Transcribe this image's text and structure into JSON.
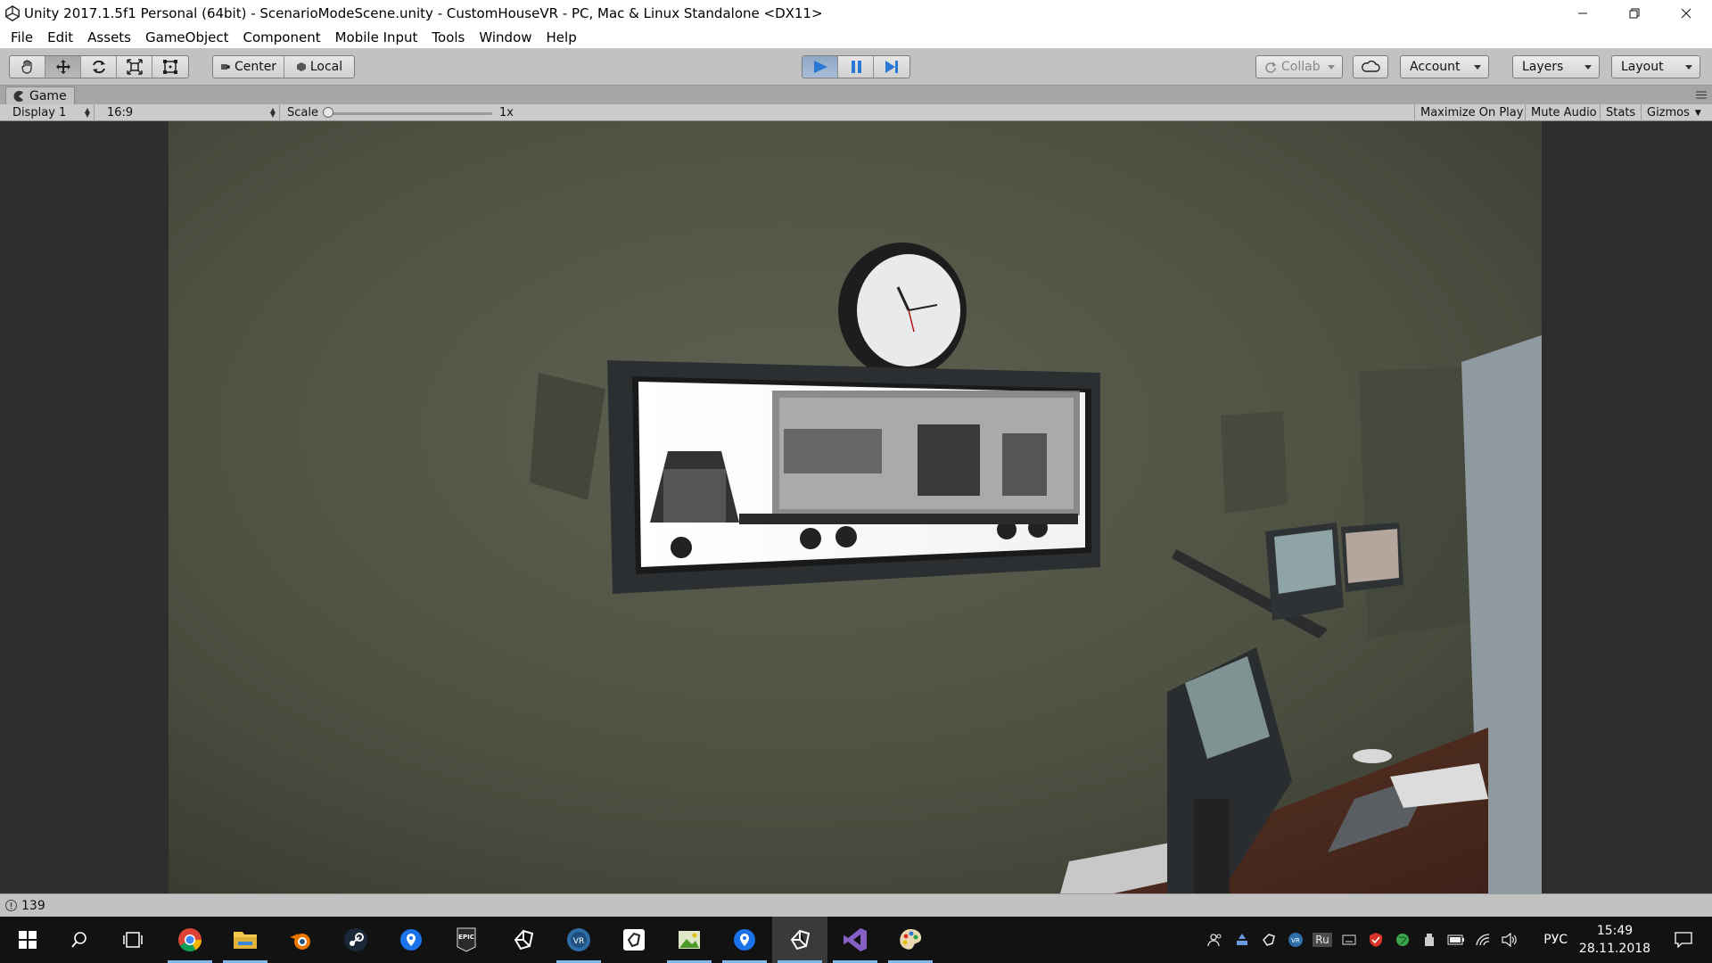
{
  "window": {
    "title": "Unity 2017.1.5f1 Personal (64bit) - ScenarioModeScene.unity - CustomHouseVR - PC, Mac & Linux Standalone <DX11>",
    "minimize_icon": "minimize-icon",
    "restore_icon": "restore-icon",
    "close_icon": "close-icon"
  },
  "menu": {
    "items": [
      "File",
      "Edit",
      "Assets",
      "GameObject",
      "Component",
      "Mobile Input",
      "Tools",
      "Window",
      "Help"
    ]
  },
  "toolbar": {
    "transform_tools": [
      "hand-tool-icon",
      "move-tool-icon",
      "rotate-tool-icon",
      "scale-tool-icon",
      "rect-tool-icon"
    ],
    "pivot_label": "Center",
    "space_label": "Local",
    "play_controls": [
      "play-icon",
      "pause-icon",
      "step-icon"
    ],
    "collab_label": "Collab",
    "cloud_icon": "cloud-icon",
    "account_label": "Account",
    "layers_label": "Layers",
    "layout_label": "Layout"
  },
  "game_panel": {
    "tab_label": "Game",
    "display_label": "Display 1",
    "aspect_label": "16:9",
    "scale_label": "Scale",
    "scale_value_label": "1x",
    "scale_value": 0.0,
    "maximize_label": "Maximize On Play",
    "mute_label": "Mute Audio",
    "stats_label": "Stats",
    "gizmos_label": "Gizmos"
  },
  "status": {
    "message_count": "139"
  },
  "taskbar": {
    "apps": [
      "windows-start-icon",
      "search-icon",
      "task-view-icon",
      "chrome-icon",
      "file-explorer-icon",
      "blender-icon",
      "steam-icon",
      "maps-icon",
      "epic-games-icon",
      "unity-icon",
      "vr-icon",
      "unity-hub-icon",
      "photo-editor-icon",
      "maps-icon-2",
      "unity-icon-2",
      "visual-studio-icon",
      "paint-icon"
    ],
    "tray_lang_code": "Ru",
    "input_lang": "РУС",
    "time": "15:49",
    "date": "28.11.2018"
  },
  "colors": {
    "play_active": "#3a86d8",
    "taskbar_bg": "#121212",
    "editor_bg": "#c2c2c2"
  }
}
